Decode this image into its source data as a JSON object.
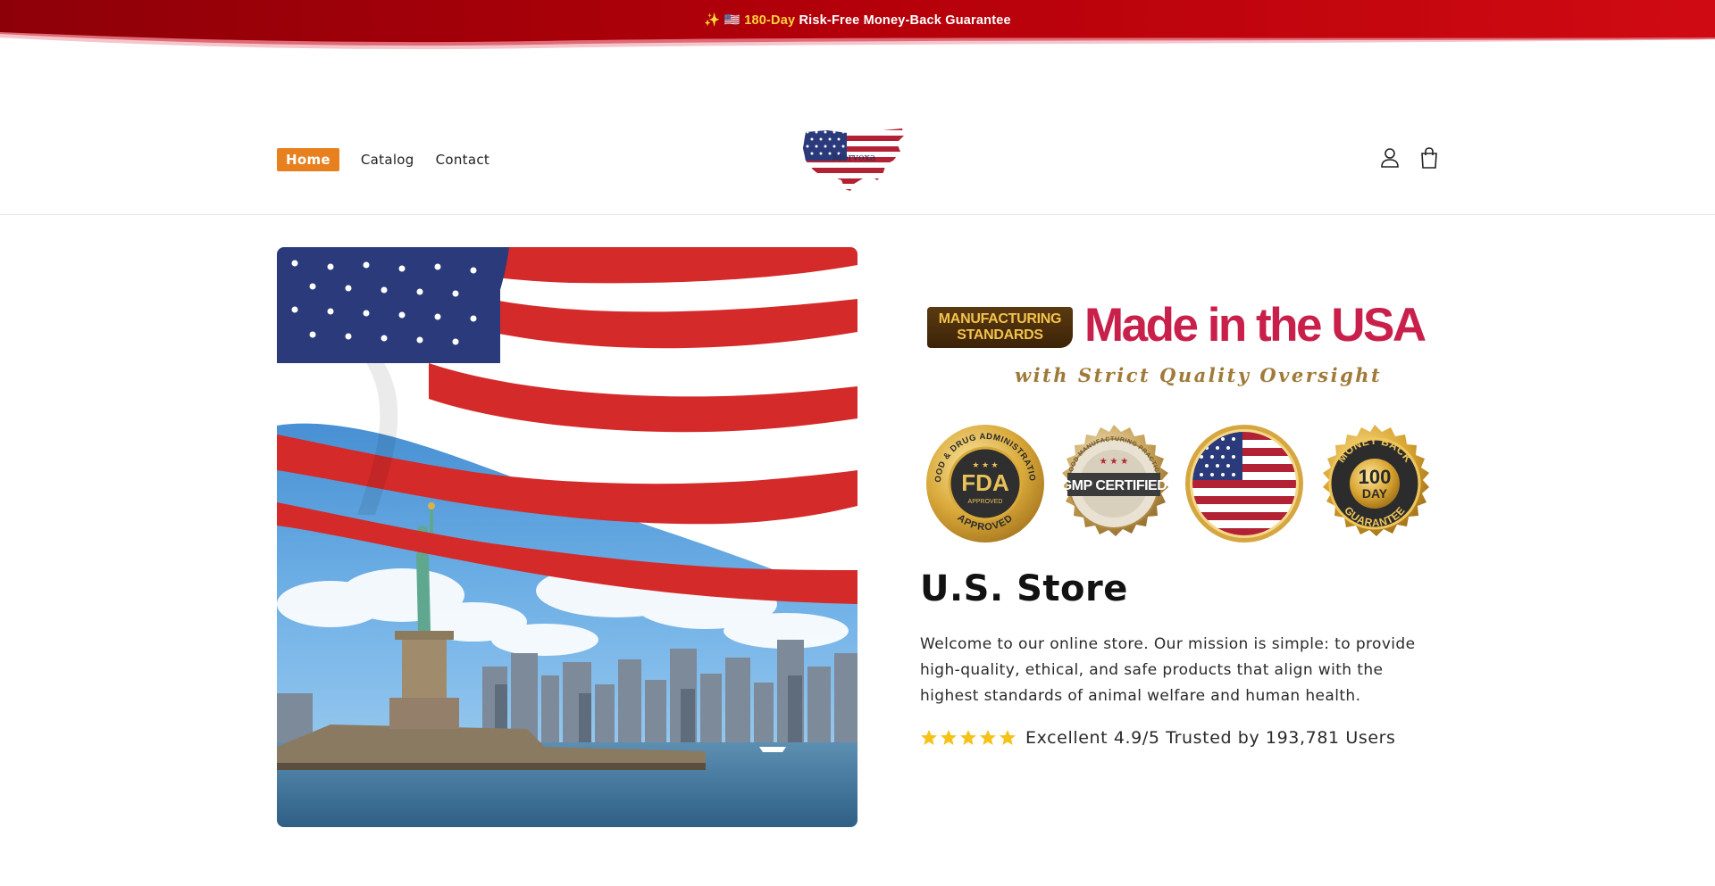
{
  "announcement": {
    "emoji": "✨ 🇺🇸",
    "highlight": "180-Day",
    "text": "Risk-Free Money-Back Guarantee"
  },
  "nav": {
    "items": [
      {
        "label": "Home",
        "active": true
      },
      {
        "label": "Catalog",
        "active": false
      },
      {
        "label": "Contact",
        "active": false
      }
    ]
  },
  "logo": {
    "label": "Morvoxa"
  },
  "header_icons": [
    "account-icon",
    "cart-icon"
  ],
  "trust_banner": {
    "badge_line1": "MANUFACTURING",
    "badge_line2": "STANDARDS",
    "headline": "Made in the USA",
    "subline": "with Strict Quality Oversight"
  },
  "seals": {
    "fda": {
      "ring": "FOOD & DRUG ADMINISTRATION",
      "center": "FDA",
      "small": "APPROVED",
      "bottom": "APPROVED"
    },
    "gmp": {
      "ring": "GOOD MANUFACTURING PRACTICE",
      "center": "GMP CERTIFIED"
    },
    "flag": {},
    "guarantee": {
      "ring_top": "MONEY BACK",
      "number": "100",
      "unit": "DAY",
      "ring_bottom": "GUARANTEE"
    }
  },
  "store": {
    "title": "U.S. Store",
    "description": "Welcome to our online store. Our mission is simple: to provide high-quality, ethical, and safe products that align with the highest standards of animal welfare and human health.",
    "rating": {
      "stars": 5,
      "text": "Excellent 4.9/5 Trusted by 193,781 Users"
    }
  },
  "colors": {
    "announcement_red": "#c0000a",
    "home_button": "#e8801f",
    "headline": "#c8204a",
    "gold": "#d8a83a",
    "star": "#f5c218"
  }
}
